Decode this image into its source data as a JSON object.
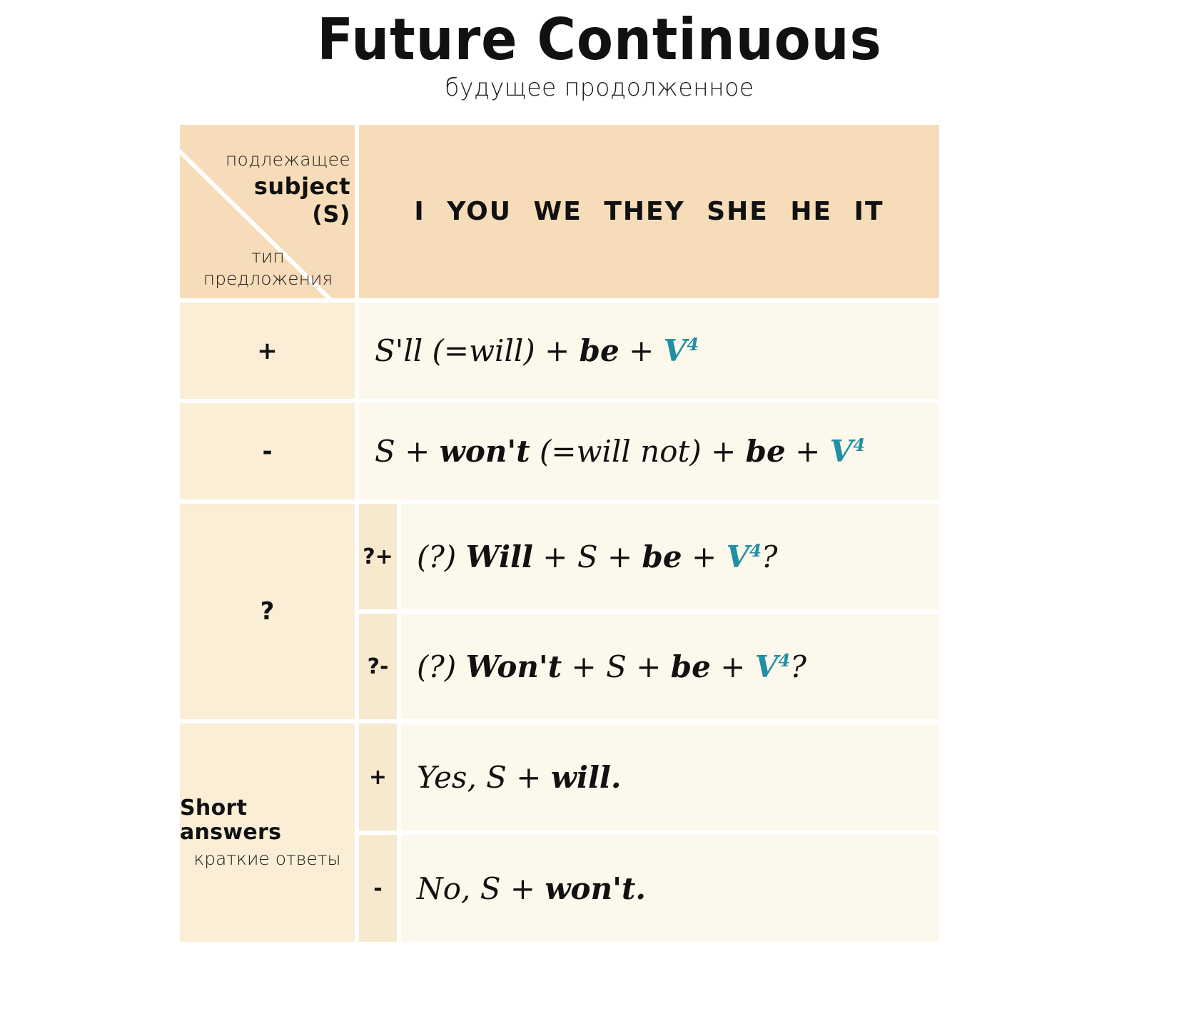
{
  "header": {
    "title": "Future Continuous",
    "subtitle": "будущее продолженное"
  },
  "table": {
    "corner": {
      "subject_ru": "подлежащее",
      "subject_en": "subject",
      "subject_abbr": "(S)",
      "type_line1": "тип",
      "type_line2": "предложения"
    },
    "pronouns": "I  YOU  WE  THEY  SHE  HE  IT",
    "rows": [
      {
        "sign": "+",
        "marker": "",
        "formula_parts": [
          {
            "text": "S'll (=will) + ",
            "style": "plain"
          },
          {
            "text": "be",
            "style": "bold"
          },
          {
            "text": " + ",
            "style": "plain"
          },
          {
            "text": "V",
            "style": "verb"
          },
          {
            "text": "4",
            "style": "sup"
          }
        ],
        "formula_text": "S'll (=will) + be + V4"
      },
      {
        "sign": "-",
        "marker": "",
        "formula_parts": [
          {
            "text": "S + ",
            "style": "plain"
          },
          {
            "text": "won't",
            "style": "bold"
          },
          {
            "text": " (=will not) + ",
            "style": "plain"
          },
          {
            "text": "be",
            "style": "bold"
          },
          {
            "text": " + ",
            "style": "plain"
          },
          {
            "text": "V",
            "style": "verb"
          },
          {
            "text": "4",
            "style": "sup"
          }
        ],
        "formula_text": "S + won't (=will not) + be + V4"
      }
    ],
    "question": {
      "sign": "?",
      "sub_rows": [
        {
          "marker": "?+",
          "formula_text": "(?) Will + S + be + V4?"
        },
        {
          "marker": "?-",
          "formula_text": "(?) Won't + S + be + V4?"
        }
      ]
    },
    "short_answers": {
      "label_en": "Short answers",
      "label_ru": "краткие ответы",
      "sub_rows": [
        {
          "marker": "+",
          "formula_text": "Yes, S + will."
        },
        {
          "marker": "-",
          "formula_text": "No, S + won't."
        }
      ]
    }
  },
  "colors": {
    "header_cell": "#f7dcb9",
    "label_cell": "#faeed6",
    "marker_cell": "#f7e9cd",
    "formula_cell": "#fdf8ec",
    "accent_teal": "#2090a5",
    "text": "#111111",
    "background": "#ffffff"
  }
}
